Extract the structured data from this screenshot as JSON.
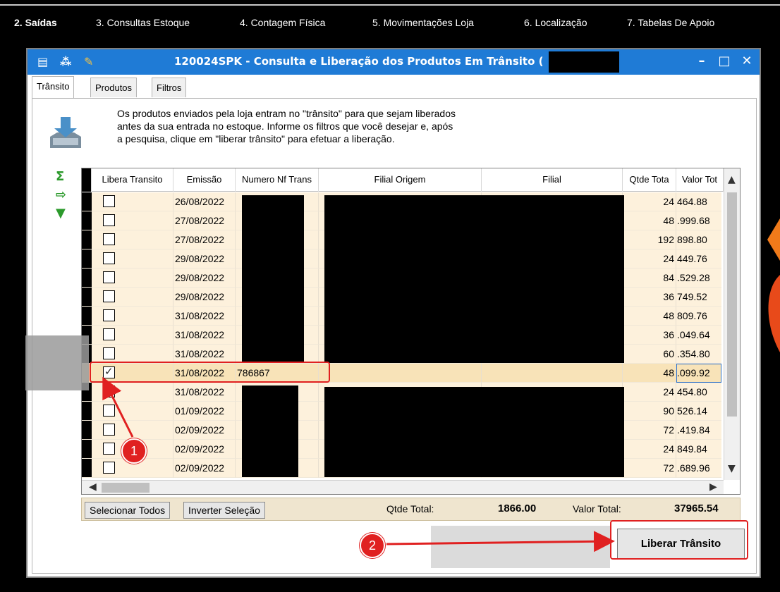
{
  "menu": {
    "items": [
      {
        "label": "2. Saídas",
        "active": true
      },
      {
        "label": "3. Consultas Estoque",
        "active": false
      },
      {
        "label": "4. Contagem Física",
        "active": false
      },
      {
        "label": "5. Movimentações Loja",
        "active": false
      },
      {
        "label": "6. Localização",
        "active": false
      },
      {
        "label": "7. Tabelas De Apoio",
        "active": false
      }
    ]
  },
  "window": {
    "title": "120024SPK - Consulta e Liberação dos Produtos Em Trânsito (",
    "tabs": [
      "Trânsito",
      "Produtos",
      "Filtros"
    ],
    "info_lines": [
      "Os produtos enviados pela loja entram no \"trânsito\" para que sejam liberados",
      "antes da sua entrada no estoque. Informe os filtros que você desejar e, após",
      "a pesquisa, clique em \"liberar trânsito\" para efetuar a liberação."
    ]
  },
  "grid": {
    "headers": [
      "Libera Transito",
      "Emissão",
      "Numero Nf Trans",
      "Filial Origem",
      "Filial",
      "Qtde Tota",
      "Valor Tot"
    ],
    "rows": [
      {
        "checked": false,
        "emissao": "26/08/2022",
        "nf": "",
        "qtde": "24",
        "valor": "464.88"
      },
      {
        "checked": false,
        "emissao": "27/08/2022",
        "nf": "",
        "qtde": "48",
        "valor": ".999.68"
      },
      {
        "checked": false,
        "emissao": "27/08/2022",
        "nf": "",
        "qtde": "192",
        "valor": "898.80"
      },
      {
        "checked": false,
        "emissao": "29/08/2022",
        "nf": "",
        "qtde": "24",
        "valor": "449.76"
      },
      {
        "checked": false,
        "emissao": "29/08/2022",
        "nf": "",
        "qtde": "84",
        "valor": ".529.28"
      },
      {
        "checked": false,
        "emissao": "29/08/2022",
        "nf": "",
        "qtde": "36",
        "valor": "749.52"
      },
      {
        "checked": false,
        "emissao": "31/08/2022",
        "nf": "",
        "qtde": "48",
        "valor": "809.76"
      },
      {
        "checked": false,
        "emissao": "31/08/2022",
        "nf": "",
        "qtde": "36",
        "valor": ".049.64"
      },
      {
        "checked": false,
        "emissao": "31/08/2022",
        "nf": "",
        "qtde": "60",
        "valor": ".354.80"
      },
      {
        "checked": true,
        "emissao": "31/08/2022",
        "nf": "786867",
        "qtde": "48",
        "valor": ".099.92",
        "selected": true
      },
      {
        "checked": false,
        "emissao": "31/08/2022",
        "nf": "",
        "qtde": "24",
        "valor": "454.80"
      },
      {
        "checked": false,
        "emissao": "01/09/2022",
        "nf": "",
        "qtde": "90",
        "valor": "526.14"
      },
      {
        "checked": false,
        "emissao": "02/09/2022",
        "nf": "",
        "qtde": "72",
        "valor": ".419.84"
      },
      {
        "checked": false,
        "emissao": "02/09/2022",
        "nf": "",
        "qtde": "24",
        "valor": "849.84"
      },
      {
        "checked": false,
        "emissao": "02/09/2022",
        "nf": "",
        "qtde": "72",
        "valor": ".689.96"
      }
    ]
  },
  "footer": {
    "select_all": "Selecionar Todos",
    "invert": "Inverter Seleção",
    "qtde_label": "Qtde Total:",
    "qtde_value": "1866.00",
    "valor_label": "Valor Total:",
    "valor_value": "37965.54"
  },
  "release_button": "Liberar Trânsito",
  "annotations": {
    "step1": "1",
    "step2": "2"
  },
  "colors": {
    "titlebar": "#1f7bd6",
    "row_bg": "#fdf1dc",
    "annotation": "#e02020"
  }
}
